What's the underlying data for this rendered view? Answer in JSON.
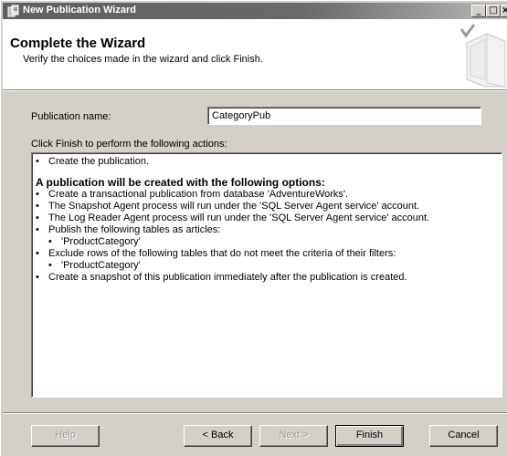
{
  "window": {
    "title": "New Publication Wizard",
    "minimize_glyph": "_",
    "maximize_glyph": "□",
    "close_glyph": "×"
  },
  "header": {
    "title": "Complete the Wizard",
    "subtitle": "Verify the choices made in the wizard and click Finish.",
    "graphic": "wizard-book-checkmark-icon"
  },
  "publication_name": {
    "label": "Publication name:",
    "value": "CategoryPub"
  },
  "actions": {
    "label": "Click Finish to perform the following actions:",
    "bullet": "•",
    "first_item": "Create the publication.",
    "options_heading": "A publication will be created with the following options:",
    "items": [
      {
        "level": 1,
        "text": "Create a transactional publication from database 'AdventureWorks'."
      },
      {
        "level": 1,
        "text": "The Snapshot Agent process will run under the 'SQL Server Agent service' account."
      },
      {
        "level": 1,
        "text": "The Log Reader Agent process will run under the 'SQL Server Agent service' account."
      },
      {
        "level": 1,
        "text": "Publish the following tables as articles:"
      },
      {
        "level": 2,
        "text": "'ProductCategory'"
      },
      {
        "level": 1,
        "text": "Exclude rows of the following tables that do not meet the criteria of their filters:"
      },
      {
        "level": 2,
        "text": "'ProductCategory'"
      },
      {
        "level": 1,
        "text": "Create a snapshot of this publication immediately after the publication is created."
      }
    ]
  },
  "buttons": {
    "help": "Help",
    "back": "< Back",
    "next": "Next >",
    "finish": "Finish",
    "cancel": "Cancel"
  }
}
